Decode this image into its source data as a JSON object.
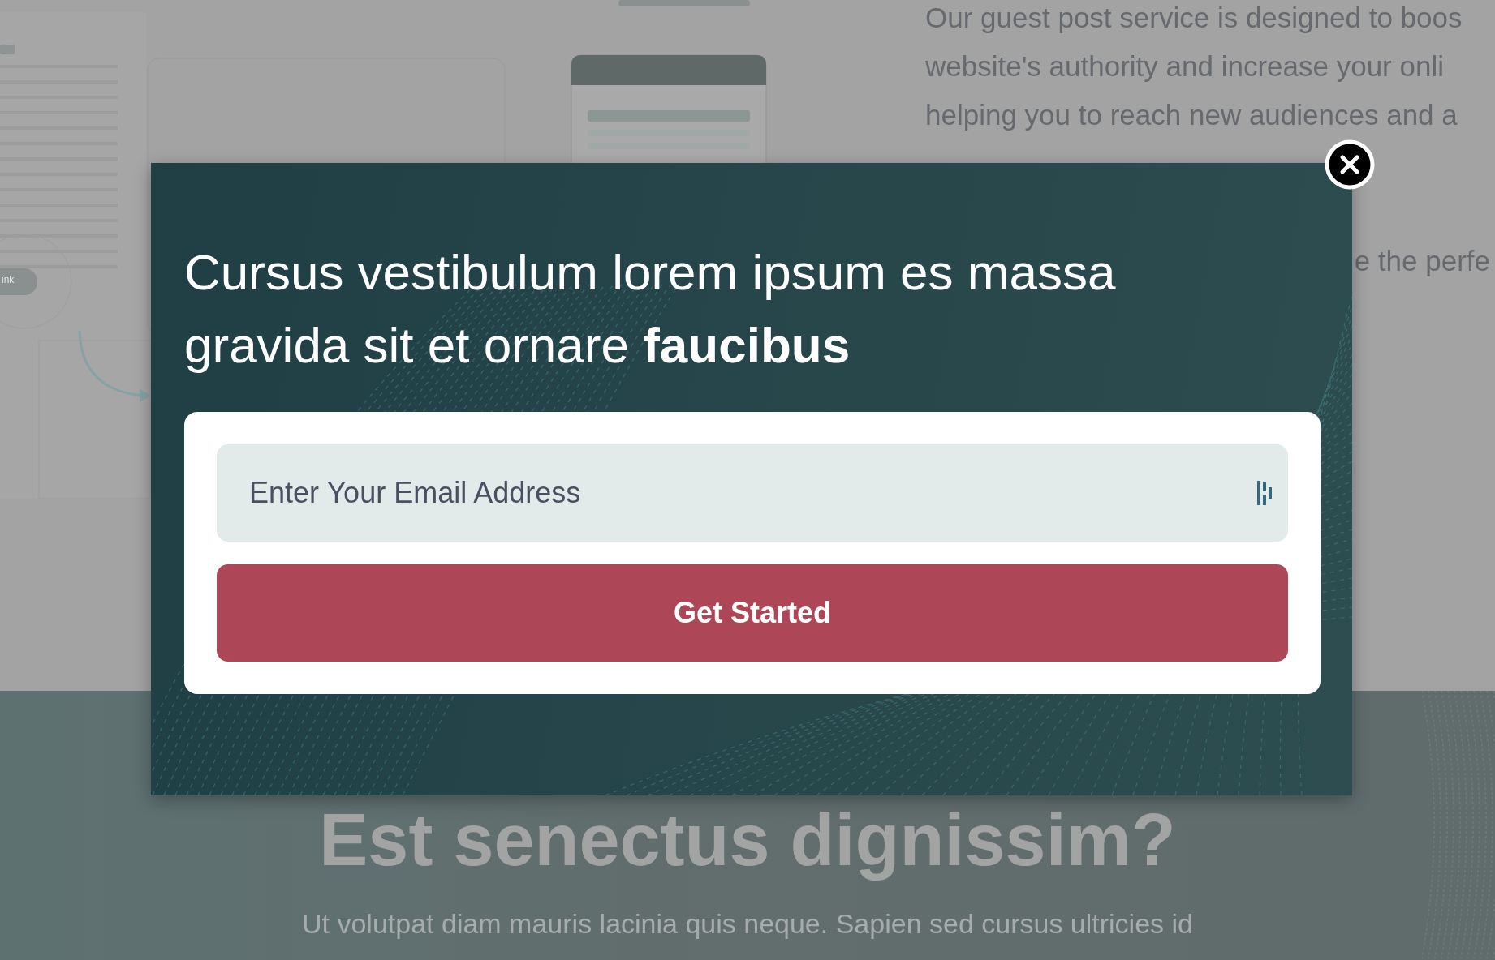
{
  "background": {
    "paragraph_lines": [
      "Our guest post service is designed to boos",
      "website's authority and increase your onli",
      "helping you to reach new audiences and a"
    ],
    "partial_line": "e the perfe",
    "pill": "ink",
    "heading": "Est senectus dignissim?",
    "subtext": "Ut volutpat diam mauris lacinia quis neque. Sapien sed cursus ultricies id"
  },
  "modal": {
    "title": "Cursus vestibulum lorem ipsum es massa gravida sit et ornare **faucibus**",
    "email": {
      "placeholder": "Enter Your Email Address"
    },
    "button": "Get Started"
  }
}
